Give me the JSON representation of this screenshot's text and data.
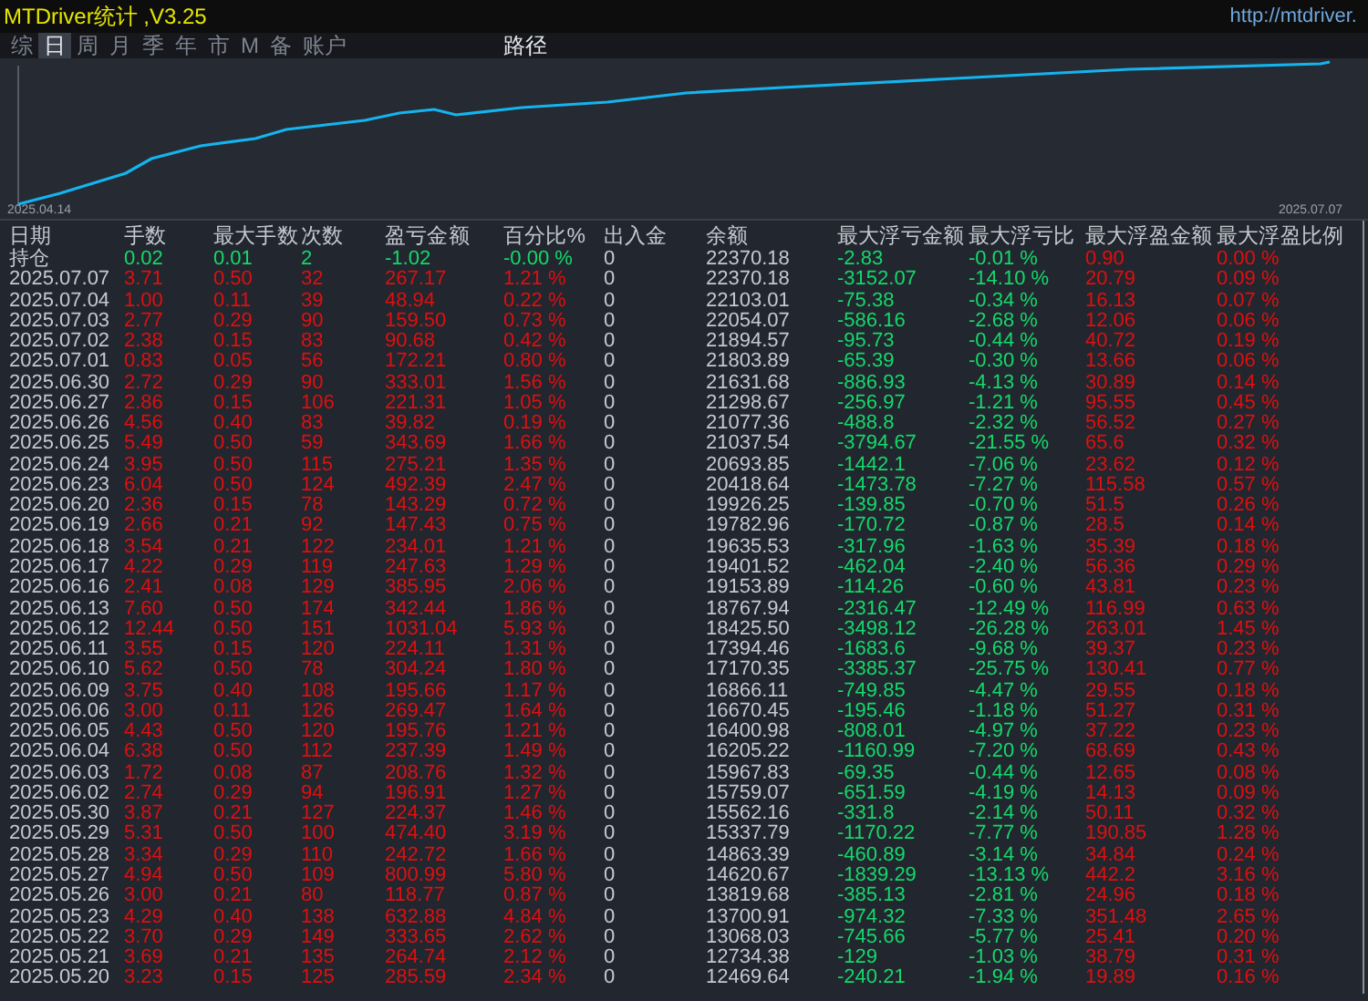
{
  "window": {
    "title": "MTDriver统计 ,V3.25",
    "url": "http://mtdriver."
  },
  "tabs": [
    {
      "label": "综",
      "selected": false
    },
    {
      "label": "日",
      "selected": true
    },
    {
      "label": "周",
      "selected": false
    },
    {
      "label": "月",
      "selected": false
    },
    {
      "label": "季",
      "selected": false
    },
    {
      "label": "年",
      "selected": false
    },
    {
      "label": "市",
      "selected": false
    },
    {
      "label": "M",
      "selected": false
    },
    {
      "label": "备",
      "selected": false
    },
    {
      "label": "账户",
      "selected": false
    },
    {
      "label": "路径",
      "selected": false
    }
  ],
  "equity_chart": {
    "start_label": "2025.04.14",
    "end_label": "2025.07.07"
  },
  "table": {
    "columns": [
      "日期",
      "手数",
      "最大手数",
      "次数",
      "盈亏金额",
      "百分比%",
      "出入金",
      "余额",
      "最大浮亏金额",
      "最大浮亏比",
      "最大浮盈金额",
      "最大浮盈比例"
    ],
    "rows": [
      {
        "kind": "open",
        "cells": [
          "持仓",
          "0.02",
          "0.01",
          "2",
          "-1.02",
          "-0.00 %",
          "0",
          "22370.18",
          "-2.83",
          "-0.01 %",
          "0.90",
          "0.00 %"
        ]
      },
      {
        "kind": "day",
        "cells": [
          "2025.07.07",
          "3.71",
          "0.50",
          "32",
          "267.17",
          "1.21 %",
          "0",
          "22370.18",
          "-3152.07",
          "-14.10 %",
          "20.79",
          "0.09 %"
        ]
      },
      {
        "kind": "day",
        "cells": [
          "2025.07.04",
          "1.00",
          "0.11",
          "39",
          "48.94",
          "0.22 %",
          "0",
          "22103.01",
          "-75.38",
          "-0.34 %",
          "16.13",
          "0.07 %"
        ]
      },
      {
        "kind": "day",
        "cells": [
          "2025.07.03",
          "2.77",
          "0.29",
          "90",
          "159.50",
          "0.73 %",
          "0",
          "22054.07",
          "-586.16",
          "-2.68 %",
          "12.06",
          "0.06 %"
        ]
      },
      {
        "kind": "day",
        "cells": [
          "2025.07.02",
          "2.38",
          "0.15",
          "83",
          "90.68",
          "0.42 %",
          "0",
          "21894.57",
          "-95.73",
          "-0.44 %",
          "40.72",
          "0.19 %"
        ]
      },
      {
        "kind": "day",
        "cells": [
          "2025.07.01",
          "0.83",
          "0.05",
          "56",
          "172.21",
          "0.80 %",
          "0",
          "21803.89",
          "-65.39",
          "-0.30 %",
          "13.66",
          "0.06 %"
        ]
      },
      {
        "kind": "day",
        "cells": [
          "2025.06.30",
          "2.72",
          "0.29",
          "90",
          "333.01",
          "1.56 %",
          "0",
          "21631.68",
          "-886.93",
          "-4.13 %",
          "30.89",
          "0.14 %"
        ]
      },
      {
        "kind": "day",
        "cells": [
          "2025.06.27",
          "2.86",
          "0.15",
          "106",
          "221.31",
          "1.05 %",
          "0",
          "21298.67",
          "-256.97",
          "-1.21 %",
          "95.55",
          "0.45 %"
        ]
      },
      {
        "kind": "day",
        "cells": [
          "2025.06.26",
          "4.56",
          "0.40",
          "83",
          "39.82",
          "0.19 %",
          "0",
          "21077.36",
          "-488.8",
          "-2.32 %",
          "56.52",
          "0.27 %"
        ]
      },
      {
        "kind": "day",
        "cells": [
          "2025.06.25",
          "5.49",
          "0.50",
          "59",
          "343.69",
          "1.66 %",
          "0",
          "21037.54",
          "-3794.67",
          "-21.55 %",
          "65.6",
          "0.32 %"
        ]
      },
      {
        "kind": "day",
        "cells": [
          "2025.06.24",
          "3.95",
          "0.50",
          "115",
          "275.21",
          "1.35 %",
          "0",
          "20693.85",
          "-1442.1",
          "-7.06 %",
          "23.62",
          "0.12 %"
        ]
      },
      {
        "kind": "day",
        "cells": [
          "2025.06.23",
          "6.04",
          "0.50",
          "124",
          "492.39",
          "2.47 %",
          "0",
          "20418.64",
          "-1473.78",
          "-7.27 %",
          "115.58",
          "0.57 %"
        ]
      },
      {
        "kind": "day",
        "cells": [
          "2025.06.20",
          "2.36",
          "0.15",
          "78",
          "143.29",
          "0.72 %",
          "0",
          "19926.25",
          "-139.85",
          "-0.70 %",
          "51.5",
          "0.26 %"
        ]
      },
      {
        "kind": "day",
        "cells": [
          "2025.06.19",
          "2.66",
          "0.21",
          "92",
          "147.43",
          "0.75 %",
          "0",
          "19782.96",
          "-170.72",
          "-0.87 %",
          "28.5",
          "0.14 %"
        ]
      },
      {
        "kind": "day",
        "cells": [
          "2025.06.18",
          "3.54",
          "0.21",
          "122",
          "234.01",
          "1.21 %",
          "0",
          "19635.53",
          "-317.96",
          "-1.63 %",
          "35.39",
          "0.18 %"
        ]
      },
      {
        "kind": "day",
        "cells": [
          "2025.06.17",
          "4.22",
          "0.29",
          "119",
          "247.63",
          "1.29 %",
          "0",
          "19401.52",
          "-462.04",
          "-2.40 %",
          "56.36",
          "0.29 %"
        ]
      },
      {
        "kind": "day",
        "cells": [
          "2025.06.16",
          "2.41",
          "0.08",
          "129",
          "385.95",
          "2.06 %",
          "0",
          "19153.89",
          "-114.26",
          "-0.60 %",
          "43.81",
          "0.23 %"
        ]
      },
      {
        "kind": "day",
        "cells": [
          "2025.06.13",
          "7.60",
          "0.50",
          "174",
          "342.44",
          "1.86 %",
          "0",
          "18767.94",
          "-2316.47",
          "-12.49 %",
          "116.99",
          "0.63 %"
        ]
      },
      {
        "kind": "day",
        "cells": [
          "2025.06.12",
          "12.44",
          "0.50",
          "151",
          "1031.04",
          "5.93 %",
          "0",
          "18425.50",
          "-3498.12",
          "-26.28 %",
          "263.01",
          "1.45 %"
        ]
      },
      {
        "kind": "day",
        "cells": [
          "2025.06.11",
          "3.55",
          "0.15",
          "120",
          "224.11",
          "1.31 %",
          "0",
          "17394.46",
          "-1683.6",
          "-9.68 %",
          "39.37",
          "0.23 %"
        ]
      },
      {
        "kind": "day",
        "cells": [
          "2025.06.10",
          "5.62",
          "0.50",
          "78",
          "304.24",
          "1.80 %",
          "0",
          "17170.35",
          "-3385.37",
          "-25.75 %",
          "130.41",
          "0.77 %"
        ]
      },
      {
        "kind": "day",
        "cells": [
          "2025.06.09",
          "3.75",
          "0.40",
          "108",
          "195.66",
          "1.17 %",
          "0",
          "16866.11",
          "-749.85",
          "-4.47 %",
          "29.55",
          "0.18 %"
        ]
      },
      {
        "kind": "day",
        "cells": [
          "2025.06.06",
          "3.00",
          "0.11",
          "126",
          "269.47",
          "1.64 %",
          "0",
          "16670.45",
          "-195.46",
          "-1.18 %",
          "51.27",
          "0.31 %"
        ]
      },
      {
        "kind": "day",
        "cells": [
          "2025.06.05",
          "4.43",
          "0.50",
          "120",
          "195.76",
          "1.21 %",
          "0",
          "16400.98",
          "-808.01",
          "-4.97 %",
          "37.22",
          "0.23 %"
        ]
      },
      {
        "kind": "day",
        "cells": [
          "2025.06.04",
          "6.38",
          "0.50",
          "112",
          "237.39",
          "1.49 %",
          "0",
          "16205.22",
          "-1160.99",
          "-7.20 %",
          "68.69",
          "0.43 %"
        ]
      },
      {
        "kind": "day",
        "cells": [
          "2025.06.03",
          "1.72",
          "0.08",
          "87",
          "208.76",
          "1.32 %",
          "0",
          "15967.83",
          "-69.35",
          "-0.44 %",
          "12.65",
          "0.08 %"
        ]
      },
      {
        "kind": "day",
        "cells": [
          "2025.06.02",
          "2.74",
          "0.29",
          "94",
          "196.91",
          "1.27 %",
          "0",
          "15759.07",
          "-651.59",
          "-4.19 %",
          "14.13",
          "0.09 %"
        ]
      },
      {
        "kind": "day",
        "cells": [
          "2025.05.30",
          "3.87",
          "0.21",
          "127",
          "224.37",
          "1.46 %",
          "0",
          "15562.16",
          "-331.8",
          "-2.14 %",
          "50.11",
          "0.32 %"
        ]
      },
      {
        "kind": "day",
        "cells": [
          "2025.05.29",
          "5.31",
          "0.50",
          "100",
          "474.40",
          "3.19 %",
          "0",
          "15337.79",
          "-1170.22",
          "-7.77 %",
          "190.85",
          "1.28 %"
        ]
      },
      {
        "kind": "day",
        "cells": [
          "2025.05.28",
          "3.34",
          "0.29",
          "110",
          "242.72",
          "1.66 %",
          "0",
          "14863.39",
          "-460.89",
          "-3.14 %",
          "34.84",
          "0.24 %"
        ]
      },
      {
        "kind": "day",
        "cells": [
          "2025.05.27",
          "4.94",
          "0.50",
          "109",
          "800.99",
          "5.80 %",
          "0",
          "14620.67",
          "-1839.29",
          "-13.13 %",
          "442.2",
          "3.16 %"
        ]
      },
      {
        "kind": "day",
        "cells": [
          "2025.05.26",
          "3.00",
          "0.21",
          "80",
          "118.77",
          "0.87 %",
          "0",
          "13819.68",
          "-385.13",
          "-2.81 %",
          "24.96",
          "0.18 %"
        ]
      },
      {
        "kind": "day",
        "cells": [
          "2025.05.23",
          "4.29",
          "0.40",
          "138",
          "632.88",
          "4.84 %",
          "0",
          "13700.91",
          "-974.32",
          "-7.33 %",
          "351.48",
          "2.65 %"
        ]
      },
      {
        "kind": "day",
        "cells": [
          "2025.05.22",
          "3.70",
          "0.29",
          "149",
          "333.65",
          "2.62 %",
          "0",
          "13068.03",
          "-745.66",
          "-5.77 %",
          "25.41",
          "0.20 %"
        ]
      },
      {
        "kind": "day",
        "cells": [
          "2025.05.21",
          "3.69",
          "0.21",
          "135",
          "264.74",
          "2.12 %",
          "0",
          "12734.38",
          "-129",
          "-1.03 %",
          "38.79",
          "0.31 %"
        ]
      },
      {
        "kind": "day",
        "cells": [
          "2025.05.20",
          "3.23",
          "0.15",
          "125",
          "285.59",
          "2.34 %",
          "0",
          "12469.64",
          "-240.21",
          "-1.94 %",
          "19.89",
          "0.16 %"
        ]
      }
    ]
  }
}
